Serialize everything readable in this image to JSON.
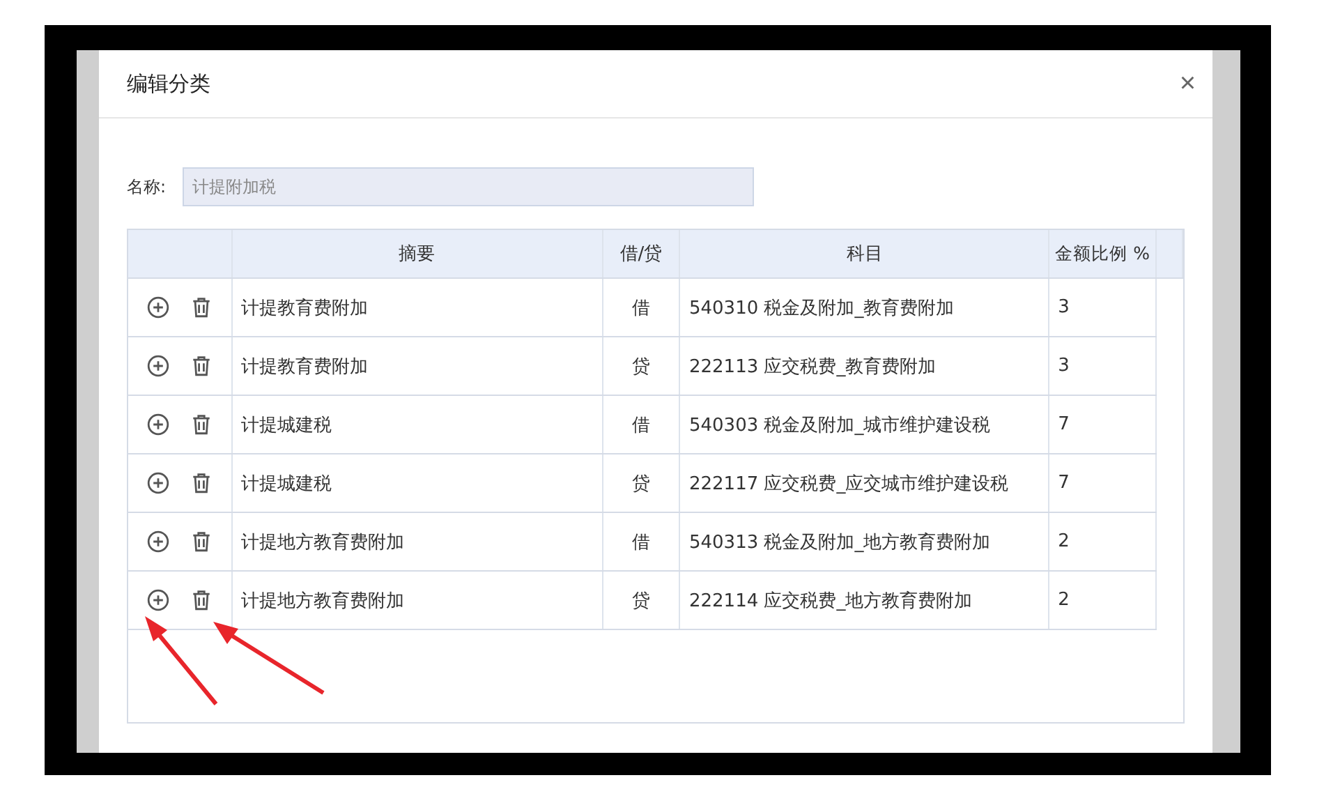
{
  "dialog": {
    "title": "编辑分类",
    "close": "×"
  },
  "name_field": {
    "label": "名称:",
    "value": "计提附加税",
    "disabled": true
  },
  "table": {
    "columns": [
      "摘要",
      "借/贷",
      "科目",
      "金额比例 %"
    ],
    "rows": [
      {
        "summary": "计提教育费附加",
        "direction": "借",
        "account": "540310 税金及附加_教育费附加",
        "ratio": "3"
      },
      {
        "summary": "计提教育费附加",
        "direction": "贷",
        "account": "222113 应交税费_教育费附加",
        "ratio": "3"
      },
      {
        "summary": "计提城建税",
        "direction": "借",
        "account": "540303 税金及附加_城市维护建设税",
        "ratio": "7"
      },
      {
        "summary": "计提城建税",
        "direction": "贷",
        "account": "222117 应交税费_应交城市维护建设税",
        "ratio": "7"
      },
      {
        "summary": "计提地方教育费附加",
        "direction": "借",
        "account": "540313 税金及附加_地方教育费附加",
        "ratio": "2"
      },
      {
        "summary": "计提地方教育费附加",
        "direction": "贷",
        "account": "222114 应交税费_地方教育费附加",
        "ratio": "2"
      }
    ]
  }
}
